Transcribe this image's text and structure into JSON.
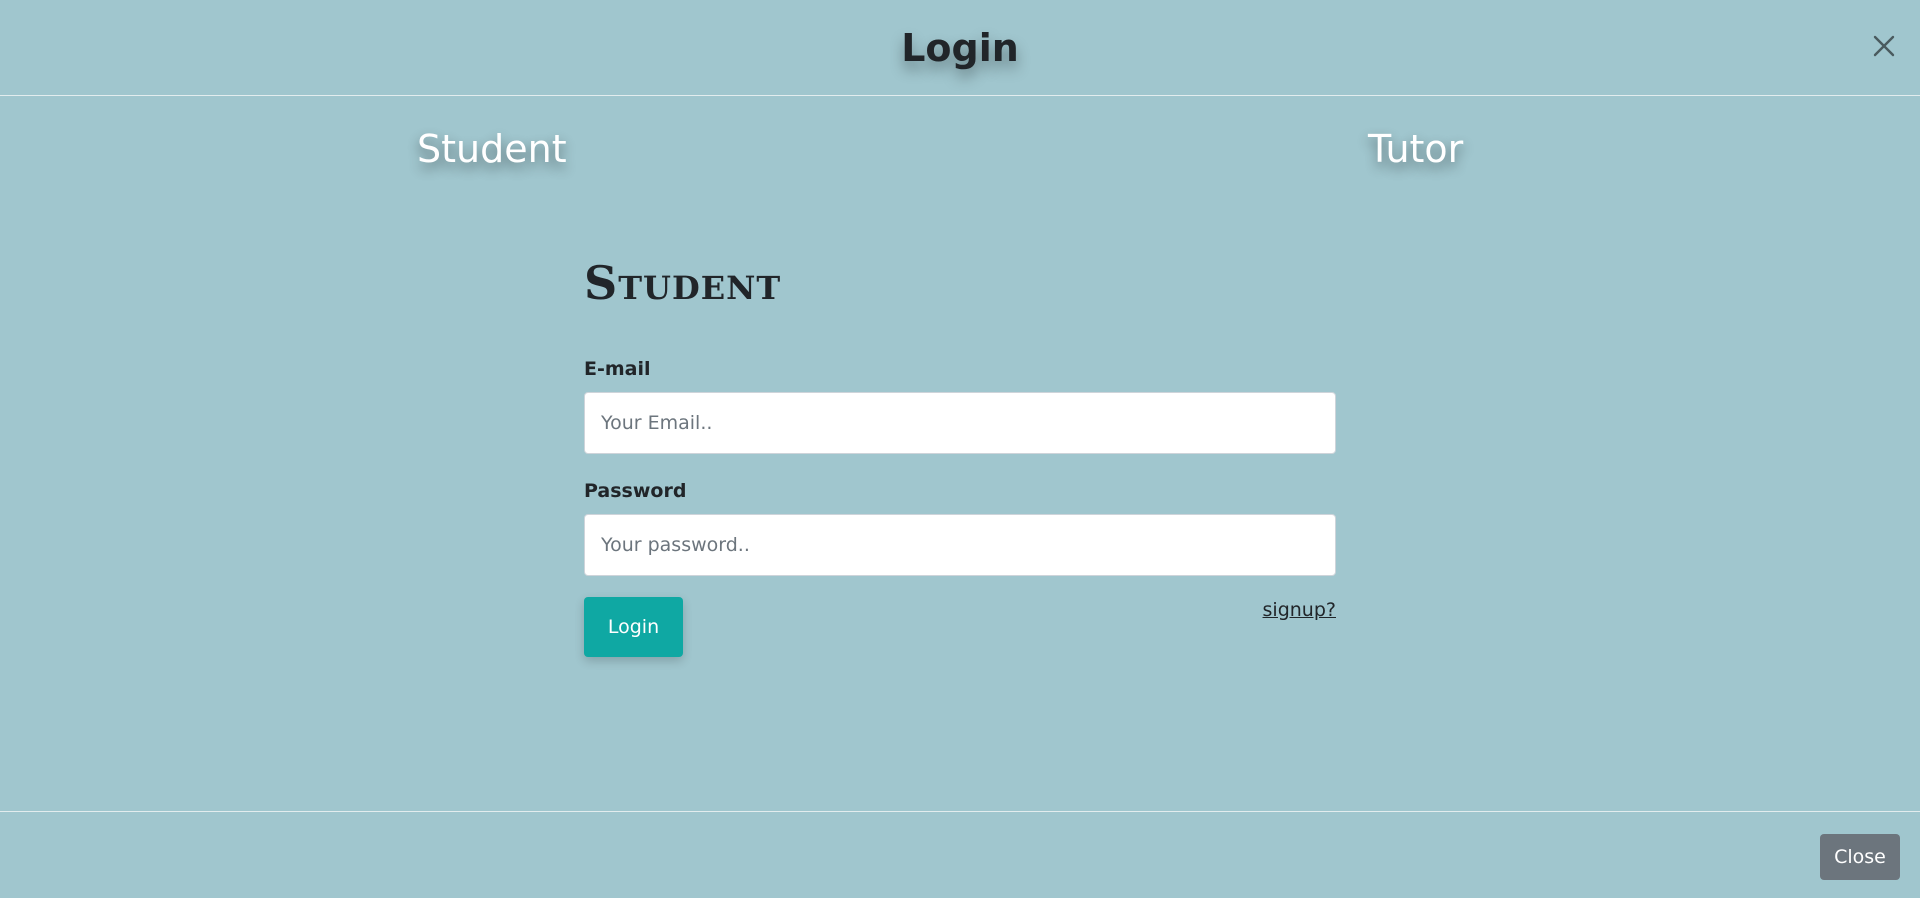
{
  "header": {
    "title": "Login",
    "close_icon": "close-icon"
  },
  "roles": {
    "student_label": "Student",
    "tutor_label": "Tutor"
  },
  "form": {
    "heading": "Student",
    "email_label": "E-mail",
    "email_placeholder": "Your Email..",
    "email_value": "",
    "password_label": "Password",
    "password_placeholder": "Your password..",
    "password_value": "",
    "login_button": "Login",
    "signup_link": "signup?"
  },
  "footer": {
    "close_button": "Close"
  },
  "colors": {
    "background": "#a0c6ce",
    "primary_button": "#0fa8a3",
    "secondary_button": "#6c757d"
  }
}
